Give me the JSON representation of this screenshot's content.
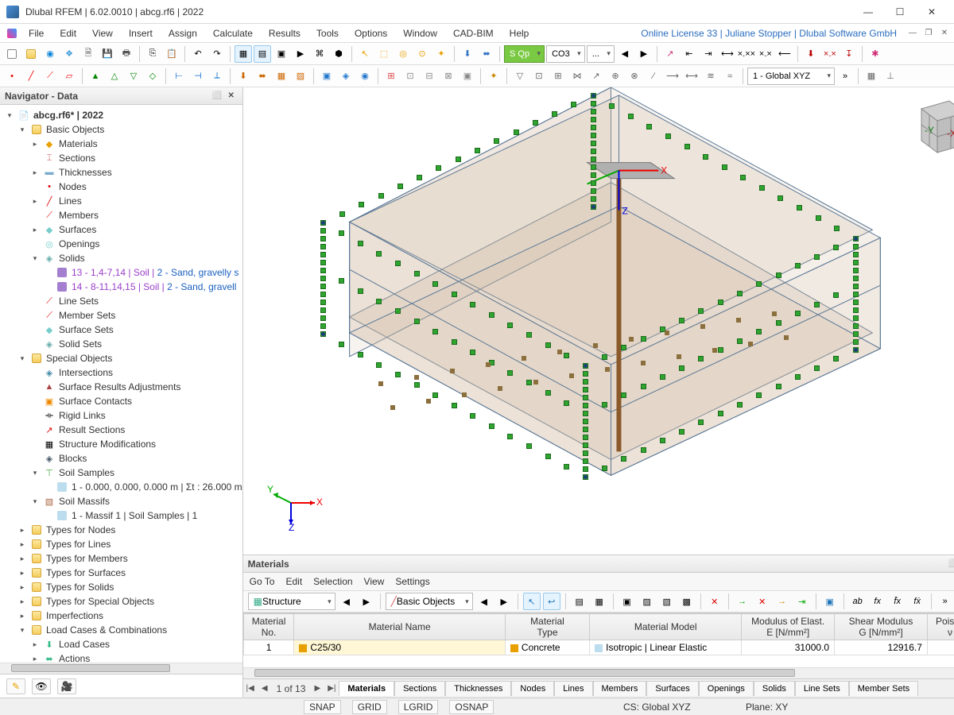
{
  "window": {
    "title": "Dlubal RFEM | 6.02.0010 | abcg.rf6 | 2022",
    "license": "Online License 33 | Juliane Stopper | Dlubal Software GmbH"
  },
  "menu": {
    "file": "File",
    "edit": "Edit",
    "view": "View",
    "insert": "Insert",
    "assign": "Assign",
    "calculate": "Calculate",
    "results": "Results",
    "tools": "Tools",
    "options": "Options",
    "window": "Window",
    "cadbim": "CAD-BIM",
    "help": "Help"
  },
  "toolbars": {
    "sqp": "S Qp",
    "co3": "CO3",
    "dots": "...",
    "cs_combo": "1 - Global XYZ"
  },
  "navigator": {
    "title": "Navigator - Data",
    "root": "abcg.rf6* | 2022",
    "basic_objects": "Basic Objects",
    "materials": "Materials",
    "sections": "Sections",
    "thicknesses": "Thicknesses",
    "nodes": "Nodes",
    "lines": "Lines",
    "members": "Members",
    "surfaces": "Surfaces",
    "openings": "Openings",
    "solids": "Solids",
    "solid1_a": "13 - 1,4-7,14 | Soil | ",
    "solid1_b": "2 - Sand, gravelly s",
    "solid2_a": "14 - 8-11,14,15 | Soil | ",
    "solid2_b": "2 - Sand, gravell",
    "line_sets": "Line Sets",
    "member_sets": "Member Sets",
    "surface_sets": "Surface Sets",
    "solid_sets": "Solid Sets",
    "special_objects": "Special Objects",
    "intersections": "Intersections",
    "surface_results_adj": "Surface Results Adjustments",
    "surface_contacts": "Surface Contacts",
    "rigid_links": "Rigid Links",
    "result_sections": "Result Sections",
    "structure_mods": "Structure Modifications",
    "blocks": "Blocks",
    "soil_samples": "Soil Samples",
    "soil_sample1": "1 - 0.000, 0.000, 0.000 m | Σt : 26.000 m",
    "soil_massifs": "Soil Massifs",
    "soil_massif1": "1 - Massif 1 | Soil Samples | 1",
    "types_nodes": "Types for Nodes",
    "types_lines": "Types for Lines",
    "types_members": "Types for Members",
    "types_surfaces": "Types for Surfaces",
    "types_solids": "Types for Solids",
    "types_special": "Types for Special Objects",
    "imperfections": "Imperfections",
    "load_cases_comb": "Load Cases & Combinations",
    "load_cases": "Load Cases",
    "actions": "Actions"
  },
  "viewport": {
    "axis_x": "X",
    "axis_y": "Y",
    "axis_z": "Z",
    "cube_y": "-Y",
    "cube_x": "-X"
  },
  "materials_panel": {
    "title": "Materials",
    "menu": {
      "goto": "Go To",
      "edit": "Edit",
      "selection": "Selection",
      "view": "View",
      "settings": "Settings"
    },
    "structure_combo": "Structure",
    "basic_objects_combo": "Basic Objects",
    "headers": {
      "no": "Material\nNo.",
      "name": "Material Name",
      "type": "Material\nType",
      "model": "Material Model",
      "elast": "Modulus of Elast.\nE [N/mm²]",
      "shear": "Shear Modulus\nG [N/mm²]",
      "poisson": "Poisson\nν ["
    },
    "row1": {
      "no": "1",
      "name": "C25/30",
      "type": "Concrete",
      "model": "Isotropic | Linear Elastic",
      "elast": "31000.0",
      "shear": "12916.7"
    },
    "page": "1 of 13",
    "tabs": {
      "materials": "Materials",
      "sections": "Sections",
      "thicknesses": "Thicknesses",
      "nodes": "Nodes",
      "lines": "Lines",
      "members": "Members",
      "surfaces": "Surfaces",
      "openings": "Openings",
      "solids": "Solids",
      "line_sets": "Line Sets",
      "member_sets": "Member Sets"
    }
  },
  "status": {
    "snap": "SNAP",
    "grid": "GRID",
    "lgrid": "LGRID",
    "osnap": "OSNAP",
    "cs": "CS: Global XYZ",
    "plane": "Plane: XY"
  }
}
